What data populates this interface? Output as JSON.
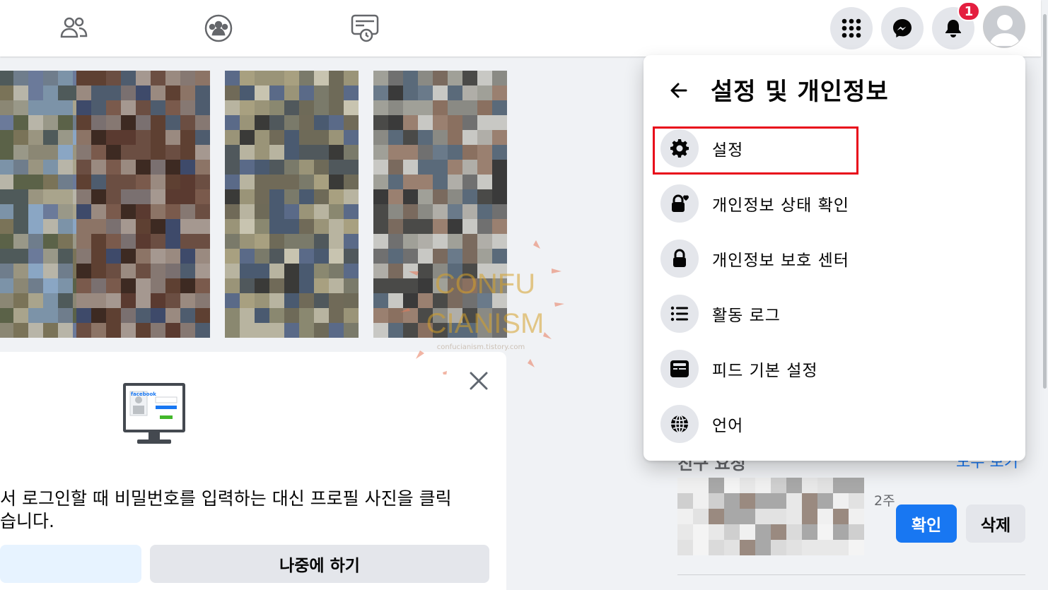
{
  "notifications": {
    "badge_count": "1"
  },
  "menu": {
    "title": "설정 및 개인정보",
    "items": [
      {
        "label": "설정",
        "icon": "gear-icon"
      },
      {
        "label": "개인정보 상태 확인",
        "icon": "lock-heart-icon"
      },
      {
        "label": "개인정보 보호 센터",
        "icon": "lock-icon"
      },
      {
        "label": "활동 로그",
        "icon": "list-icon"
      },
      {
        "label": "피드 기본 설정",
        "icon": "feed-icon"
      },
      {
        "label": "언어",
        "icon": "globe-icon"
      }
    ]
  },
  "card": {
    "text_line1": "서 로그인할 때 비밀번호를 입력하는 대신 프로필 사진을 클릭",
    "text_line2": "습니다.",
    "later_button": "나중에 하기",
    "monitor_label": "facebook"
  },
  "friend_requests": {
    "title": "친구 요청",
    "see_all": "모두 보기",
    "time": "2주",
    "confirm": "확인",
    "delete": "삭제"
  },
  "watermark": {
    "line1": "CONFU",
    "line2": "CIANISM",
    "url": "confucianism.tistory.com"
  },
  "colors": {
    "accent": "#1877f2",
    "badge": "#e41e3f",
    "highlight": "#e8091a",
    "background": "#f0f2f5"
  }
}
